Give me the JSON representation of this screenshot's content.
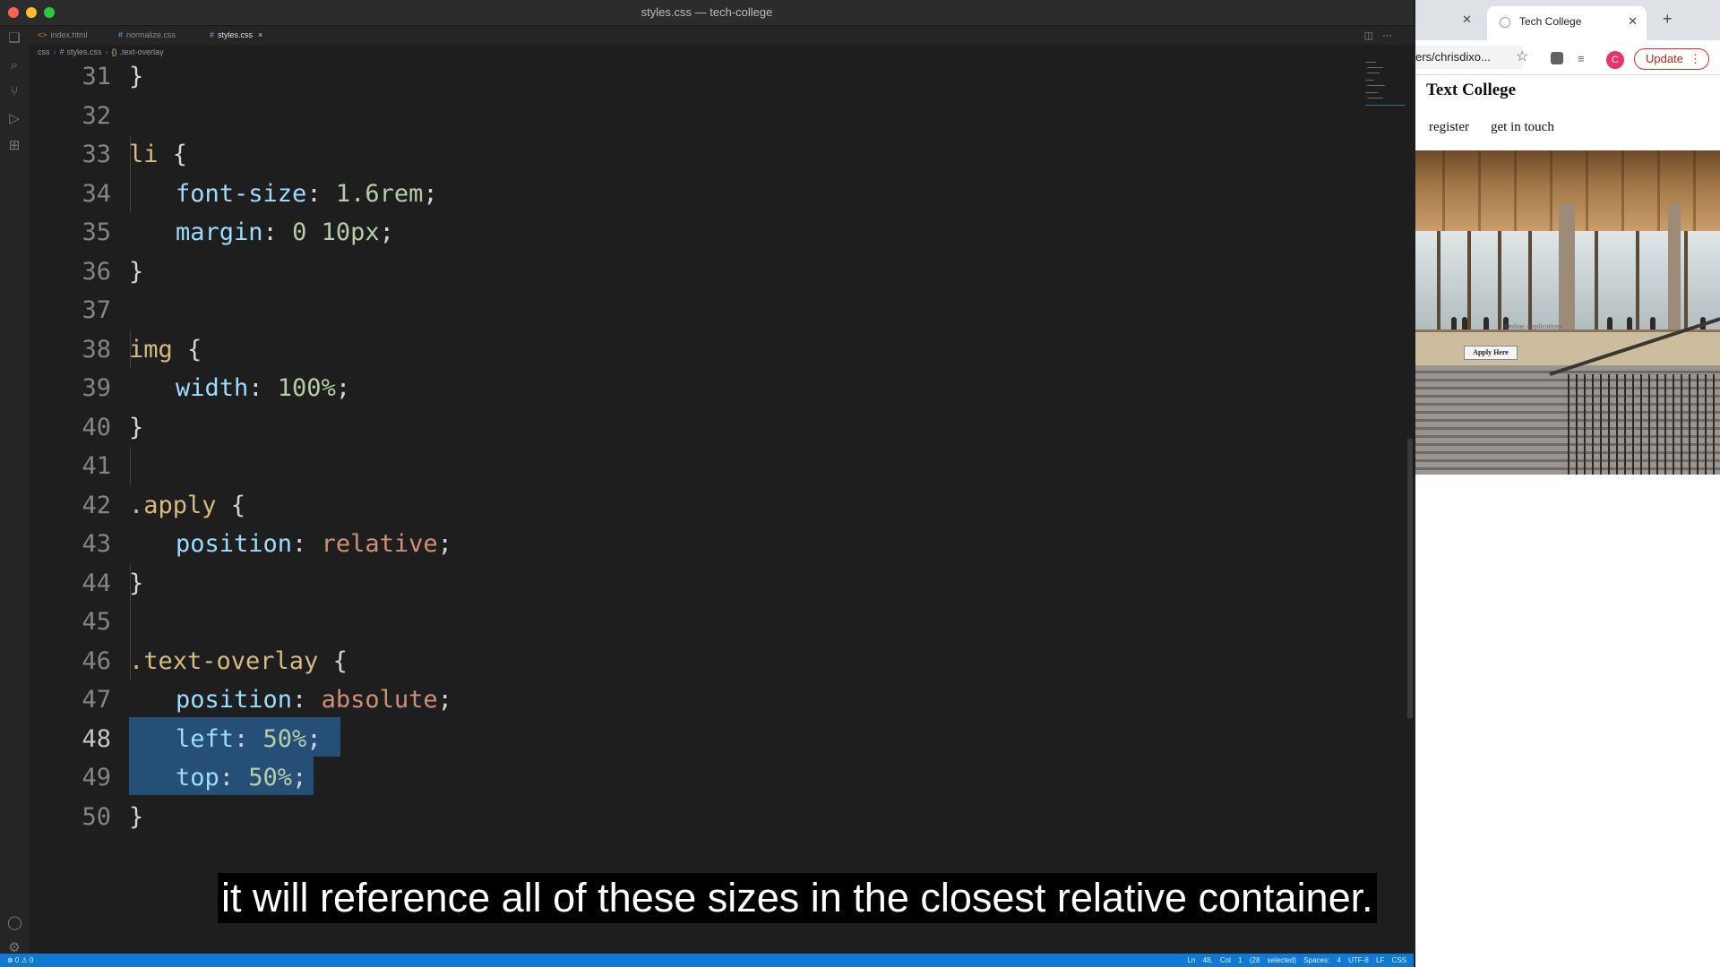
{
  "window_title": "styles.css — tech-college",
  "tabs": [
    {
      "label": "index.html",
      "icon": "<>"
    },
    {
      "label": "normalize.css",
      "icon": "#"
    },
    {
      "label": "styles.css",
      "icon": "#",
      "close": "×"
    }
  ],
  "breadcrumb": [
    "css",
    "styles.css",
    ".text-overlay"
  ],
  "breadcrumb_icons": {
    "css_file": "#",
    "symbol": "{}"
  },
  "editor": {
    "lines": [
      {
        "n": "31",
        "code": "}"
      },
      {
        "n": "32",
        "code": ""
      },
      {
        "n": "33",
        "code": "li {"
      },
      {
        "n": "34",
        "code": "font-size: 1.6rem;"
      },
      {
        "n": "35",
        "code": "margin: 0 10px;"
      },
      {
        "n": "36",
        "code": "}"
      },
      {
        "n": "37",
        "code": ""
      },
      {
        "n": "38",
        "code": "img {"
      },
      {
        "n": "39",
        "code": "width: 100%;"
      },
      {
        "n": "40",
        "code": "}"
      },
      {
        "n": "41",
        "code": ""
      },
      {
        "n": "42",
        "code": ".apply {"
      },
      {
        "n": "43",
        "code": "position: relative;"
      },
      {
        "n": "44",
        "code": "}"
      },
      {
        "n": "45",
        "code": ""
      },
      {
        "n": "46",
        "code": ".text-overlay {"
      },
      {
        "n": "47",
        "code": "position: absolute;"
      },
      {
        "n": "48",
        "code": "left: 50%;"
      },
      {
        "n": "49",
        "code": "top: 50%;"
      },
      {
        "n": "50",
        "code": "}"
      }
    ],
    "current_line": "48"
  },
  "statusbar": {
    "left": "⊗ 0 ⚠ 0",
    "right": "Ln 48, Col 1 (28 selected)   Spaces: 4   UTF-8   LF   CSS"
  },
  "browser": {
    "tab_title": "Tech College",
    "url": "ers/chrisdixo...",
    "avatar": "C",
    "update_label": "Update",
    "page": {
      "site_title": "Text College",
      "nav": [
        "register",
        "get in touch"
      ],
      "hero_overlay_text": "Online Applications",
      "apply_button": "Apply Here"
    }
  },
  "caption": "it will reference all of these sizes in the closest relative container.",
  "colors": {
    "editor_bg": "#1e1e1e",
    "selector": "#d7ba7d",
    "property": "#9cdcfe",
    "number": "#b5cea8",
    "value": "#ce9178",
    "selection": "#264f78",
    "statusbar": "#0e7ad3"
  }
}
